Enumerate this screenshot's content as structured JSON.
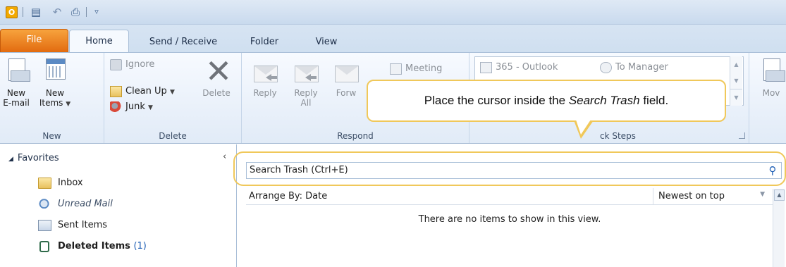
{
  "qat": {
    "app_icon": "O",
    "icons": [
      "send-receive-all-icon",
      "undo-icon",
      "print-icon",
      "customize-qat-icon"
    ]
  },
  "tabs": [
    {
      "label": "File"
    },
    {
      "label": "Home"
    },
    {
      "label": "Send / Receive"
    },
    {
      "label": "Folder"
    },
    {
      "label": "View"
    }
  ],
  "ribbon": {
    "new_group": {
      "label": "New",
      "new_email": "New E-mail",
      "new_email_l1": "New",
      "new_email_l2": "E-mail",
      "new_items_l1": "New",
      "new_items_l2": "Items"
    },
    "delete_group": {
      "label": "Delete",
      "ignore": "Ignore",
      "clean_up": "Clean Up",
      "junk": "Junk",
      "delete": "Delete"
    },
    "respond_group": {
      "label": "Respond",
      "reply": "Reply",
      "reply_all_l1": "Reply",
      "reply_all_l2": "All",
      "forward": "Forw",
      "meeting": "Meeting"
    },
    "quick_steps_group": {
      "label": "Quick Steps",
      "label_visible": "ck Steps",
      "item1": "365 - Outlook",
      "item2": "To Manager"
    },
    "move_group": {
      "move": "Mov"
    }
  },
  "callout": {
    "text_pre": "Place the cursor inside the ",
    "text_em": "Search Trash",
    "text_post": " field."
  },
  "nav": {
    "favorites": "Favorites",
    "items": [
      {
        "label": "Inbox"
      },
      {
        "label": "Unread Mail"
      },
      {
        "label": "Sent Items"
      },
      {
        "label": "Deleted Items",
        "count": "(1)"
      }
    ]
  },
  "content": {
    "search_placeholder": "Search Trash (Ctrl+E)",
    "arrange_by": "Arrange By: Date",
    "order": "Newest on top",
    "empty_message": "There are no items to show in this view."
  },
  "colors": {
    "file_tab": "#e26b10",
    "callout_border": "#f0c85a",
    "accent_blue": "#1f5fb5"
  }
}
